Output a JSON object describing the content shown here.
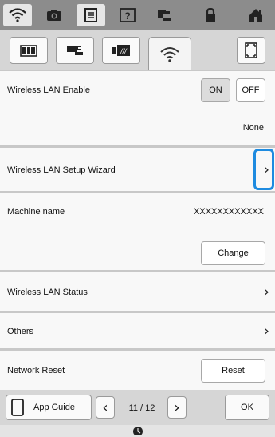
{
  "topbar": {
    "icons": [
      "wifi-icon",
      "camera-icon",
      "document-icon",
      "help-icon",
      "sewing-machine-icon",
      "lock-icon",
      "home-icon"
    ]
  },
  "tabs": [
    "machine-settings-icon",
    "sewing-settings-icon",
    "embroidery-settings-icon",
    "wireless-icon"
  ],
  "rows": {
    "wlan_enable_label": "Wireless LAN Enable",
    "on_label": "ON",
    "off_label": "OFF",
    "ssid_value": "None",
    "setup_wizard_label": "Wireless LAN Setup Wizard",
    "machine_name_label": "Machine name",
    "machine_name_value": "XXXXXXXXXXXX",
    "change_label": "Change",
    "status_label": "Wireless LAN Status",
    "others_label": "Others",
    "network_reset_label": "Network Reset",
    "reset_label": "Reset"
  },
  "bottom": {
    "app_guide_label": "App Guide",
    "page_current": "11",
    "page_separator": "/",
    "page_total": "12",
    "ok_label": "OK"
  },
  "colors": {
    "highlight": "#1e8be0",
    "topbar": "#8c8c8c"
  }
}
